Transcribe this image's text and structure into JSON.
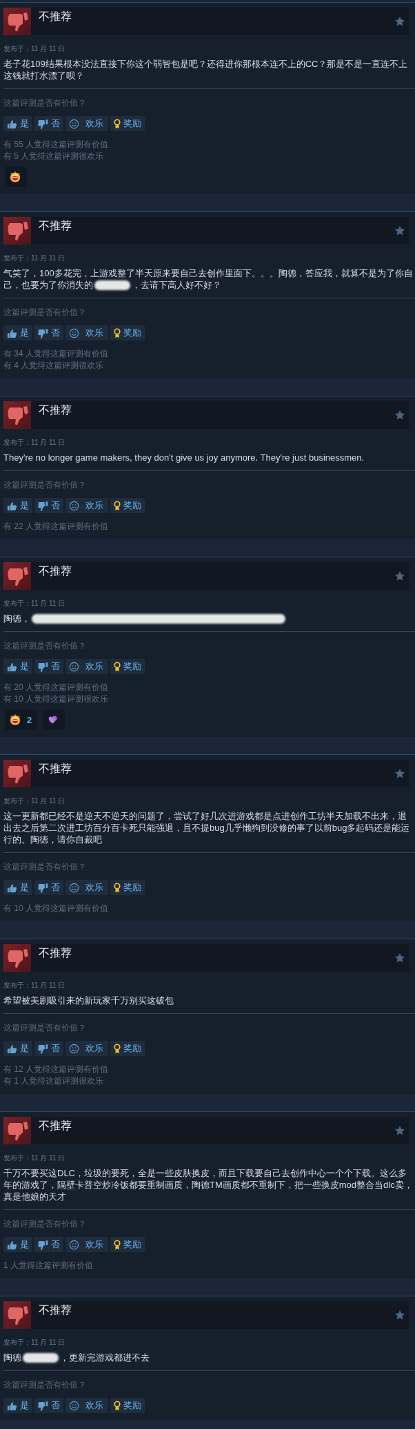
{
  "reviews": [
    {
      "verdict": "不推荐",
      "date": "发布于：11 月 11 日",
      "body": [
        {
          "kind": "text",
          "text": "老子花109结果根本没法直接下你这个弱智包是吧？还得进你那根本连不上的CC？那是不是一直连不上这钱就打水漂了呗？"
        }
      ],
      "question": "这篇评测是否有价值？",
      "buttons": [
        {
          "kind": "yes",
          "label": "是"
        },
        {
          "kind": "no",
          "label": "否"
        },
        {
          "kind": "funny",
          "label": "欢乐"
        },
        {
          "kind": "award",
          "label": "奖励"
        }
      ],
      "stats": [
        "有 55 人觉得这篇评测有价值",
        "有 5 人觉得这篇评测很欢乐"
      ],
      "reactions": [
        {
          "kind": "laugh"
        }
      ]
    },
    {
      "verdict": "不推荐",
      "date": "发布于：11 月 11 日",
      "body": [
        {
          "kind": "text",
          "text": "气笑了，100多花完，上游戏整了半天原来要自己去创作里面下。。。陶德，答应我，就算不是为了你自"
        },
        {
          "kind": "text",
          "text": "己，也要为了你消失的"
        },
        {
          "kind": "blot"
        },
        {
          "kind": "text",
          "text": "，去请下高人好不好？"
        }
      ],
      "question": "这篇评测是否有价值？",
      "buttons": [
        {
          "kind": "yes",
          "label": "是"
        },
        {
          "kind": "no",
          "label": "否"
        },
        {
          "kind": "funny",
          "label": "欢乐"
        },
        {
          "kind": "award",
          "label": "奖励"
        }
      ],
      "stats": [
        "有 34 人觉得这篇评测有价值",
        "有 4 人觉得这篇评测很欢乐"
      ]
    },
    {
      "verdict": "不推荐",
      "date": "发布于：11 月 11 日",
      "body": [
        {
          "kind": "text",
          "text": "They're no longer game makers, they don't give us joy anymore. They're just businessmen."
        }
      ],
      "question": "这篇评测是否有价值？",
      "buttons": [
        {
          "kind": "yes",
          "label": "是"
        },
        {
          "kind": "no",
          "label": "否"
        },
        {
          "kind": "funny",
          "label": "欢乐"
        },
        {
          "kind": "award",
          "label": "奖励"
        }
      ],
      "stats": [
        "有 22 人觉得这篇评测有价值"
      ]
    },
    {
      "verdict": "不推荐",
      "date": "发布于：11 月 11 日",
      "body": [
        {
          "kind": "text",
          "text": "陶德，"
        },
        {
          "kind": "smear"
        }
      ],
      "question": "这篇评测是否有价值？",
      "buttons": [
        {
          "kind": "yes",
          "label": "是"
        },
        {
          "kind": "no",
          "label": "否"
        },
        {
          "kind": "funny",
          "label": "欢乐"
        },
        {
          "kind": "award",
          "label": "奖励"
        }
      ],
      "stats": [
        "有 20 人觉得这篇评测有价值",
        "有 10 人觉得这篇评测很欢乐"
      ],
      "reactions": [
        {
          "kind": "laugh",
          "count": "2"
        },
        {
          "kind": "hearts"
        }
      ]
    },
    {
      "verdict": "不推荐",
      "date": "发布于：11 月 11 日",
      "body": [
        {
          "kind": "text",
          "text": "这一更新都已经不是逆天不逆天的问题了，尝试了好几次进游戏都是点进创作工坊半天加载不出来，退出去之后第二次进工坊百分百卡死只能强退，且不提bug几乎懒狗到没修的事了以前bug多起码还是能运行的。陶德，请你自裁吧"
        }
      ],
      "question": "这篇评测是否有价值？",
      "buttons": [
        {
          "kind": "yes",
          "label": "是"
        },
        {
          "kind": "no",
          "label": "否"
        },
        {
          "kind": "funny",
          "label": "欢乐"
        },
        {
          "kind": "award",
          "label": "奖励"
        }
      ],
      "stats": [
        "有 10 人觉得这篇评测有价值"
      ]
    },
    {
      "verdict": "不推荐",
      "date": "发布于：11 月 11 日",
      "body": [
        {
          "kind": "text",
          "text": "希望被美剧吸引来的新玩家千万别买这破包"
        }
      ],
      "question": "这篇评测是否有价值？",
      "buttons": [
        {
          "kind": "yes",
          "label": "是"
        },
        {
          "kind": "no",
          "label": "否"
        },
        {
          "kind": "funny",
          "label": "欢乐"
        },
        {
          "kind": "award",
          "label": "奖励"
        }
      ],
      "stats": [
        "有 12 人觉得这篇评测有价值",
        "有 1 人觉得这篇评测很欢乐"
      ]
    },
    {
      "verdict": "不推荐",
      "date": "发布于：11 月 11 日",
      "body": [
        {
          "kind": "text",
          "text": "千万不要买这DLC，垃圾的要死，全是一些皮肤换皮，而且下载要自己去创作中心一个个下载。这么多年的游戏了，隔壁卡普空炒冷饭都要重制画质，陶德TM画质都不重制下，把一些换皮mod整合当dlc卖，真是他娘的天才"
        }
      ],
      "question": "这篇评测是否有价值？",
      "buttons": [
        {
          "kind": "yes",
          "label": "是"
        },
        {
          "kind": "no",
          "label": "否"
        },
        {
          "kind": "funny",
          "label": "欢乐"
        },
        {
          "kind": "award",
          "label": "奖励"
        }
      ],
      "stats": [
        "1 人觉得这篇评测有价值"
      ]
    },
    {
      "verdict": "不推荐",
      "date": "发布于：11 月 11 日",
      "body": [
        {
          "kind": "text",
          "text": "陶德"
        },
        {
          "kind": "blot"
        },
        {
          "kind": "text",
          "text": "，更新完游戏都进不去"
        }
      ],
      "question": "这篇评测是否有价值？",
      "buttons": [
        {
          "kind": "yes",
          "label": "是"
        },
        {
          "kind": "no",
          "label": "否"
        },
        {
          "kind": "funny",
          "label": "欢乐"
        },
        {
          "kind": "award",
          "label": "奖励"
        }
      ]
    }
  ]
}
